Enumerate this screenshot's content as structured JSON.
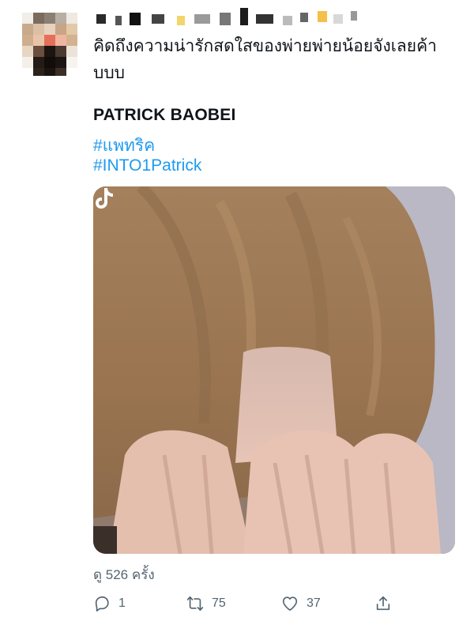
{
  "tweet": {
    "text": "คิดถึงความน่ารักสดใสของพ่ายพ่ายน้อยจังเลยค้าบบบ",
    "title": "PATRICK BAOBEI",
    "hashtags": [
      "#แพทริค",
      "#INTO1Patrick"
    ]
  },
  "views": {
    "label": "ดู 526 ครั้ง"
  },
  "actions": {
    "reply_count": "1",
    "retweet_count": "75",
    "like_count": "37"
  },
  "icons": {
    "reply": "reply-icon",
    "retweet": "retweet-icon",
    "like": "heart-icon",
    "share": "share-icon",
    "media_watermark": "tiktok-icon"
  },
  "colors": {
    "hashtag": "#1d9bf0",
    "muted": "#536471",
    "text": "#0f1419"
  }
}
